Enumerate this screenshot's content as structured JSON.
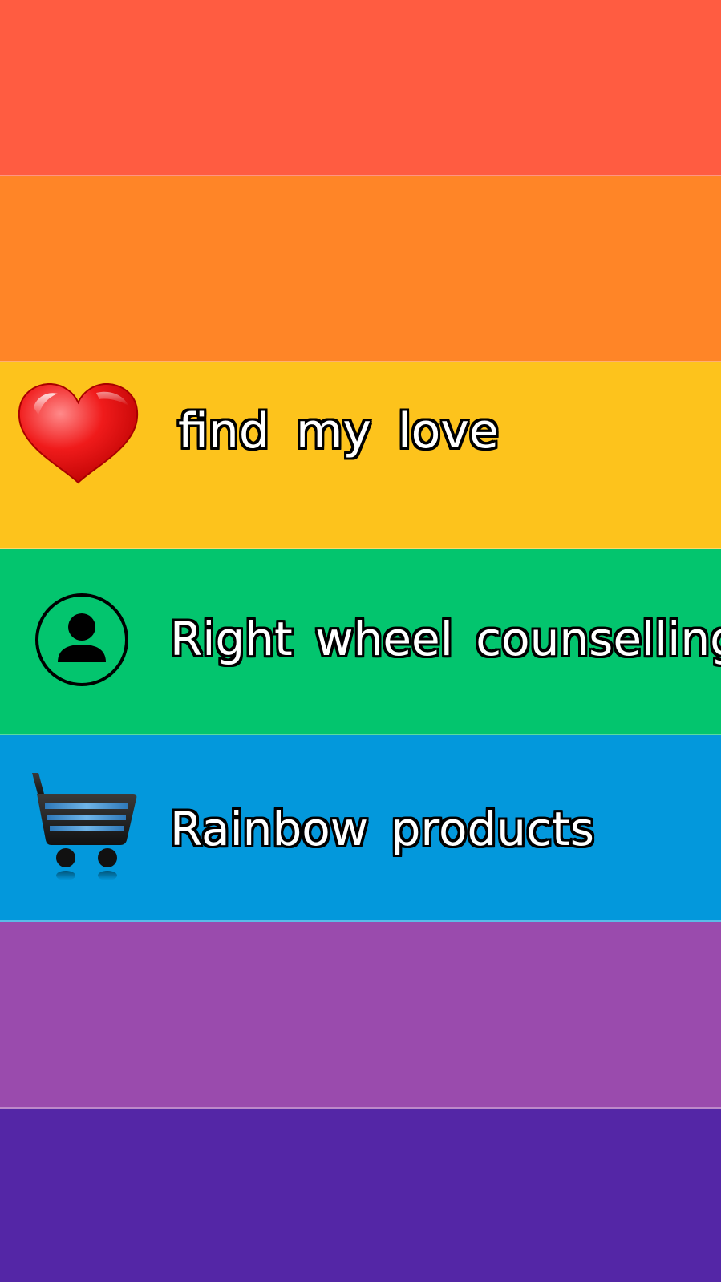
{
  "colors": {
    "band_1": "#FF5C41",
    "band_2": "#FF8527",
    "band_3": "#FDC31C",
    "band_4": "#03C56E",
    "band_5": "#0398DC",
    "band_6": "#9A4BAD",
    "band_7": "#5426A6"
  },
  "menu": {
    "items": [
      {
        "label": "find my love",
        "icon": "heart-icon"
      },
      {
        "label": "Right wheel counselling",
        "icon": "person-circle-icon"
      },
      {
        "label": "Rainbow products",
        "icon": "shopping-cart-icon"
      }
    ]
  }
}
